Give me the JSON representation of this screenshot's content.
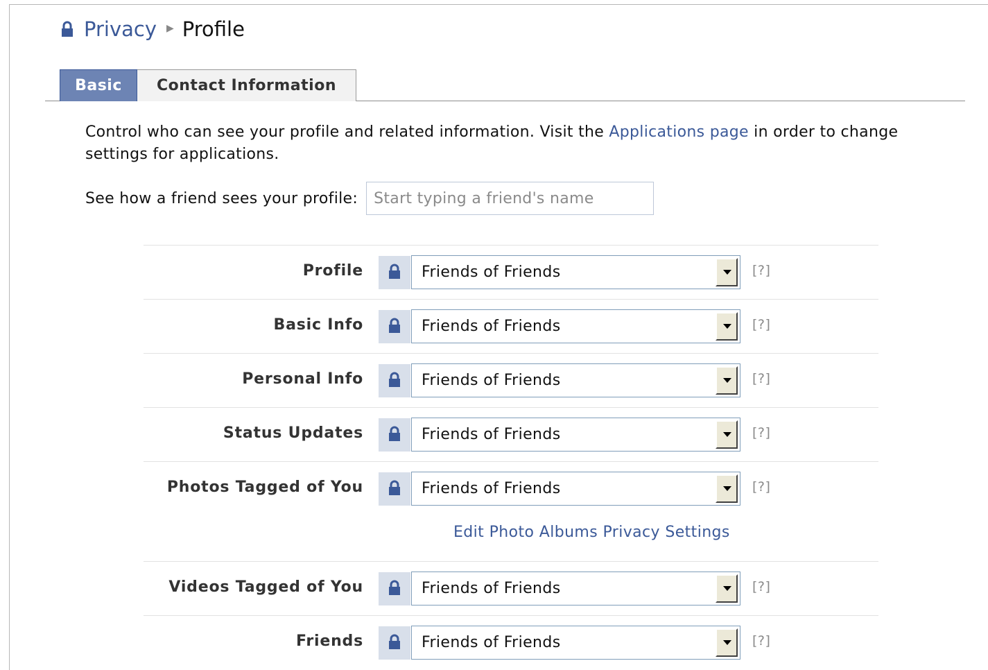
{
  "breadcrumb": {
    "icon": "lock-icon",
    "parent": "Privacy",
    "separator": "▶",
    "current": "Profile"
  },
  "tabs": [
    {
      "label": "Basic",
      "active": true
    },
    {
      "label": "Contact Information",
      "active": false
    }
  ],
  "description": {
    "before_link": "Control who can see your profile and related information. Visit the ",
    "link": "Applications page",
    "after_link": " in order to change settings for applications."
  },
  "preview": {
    "label": "See how a friend sees your profile:",
    "placeholder": "Start typing a friend's name",
    "value": ""
  },
  "settings": [
    {
      "label": "Profile",
      "value": "Friends of Friends",
      "help": "[?]"
    },
    {
      "label": "Basic Info",
      "value": "Friends of Friends",
      "help": "[?]"
    },
    {
      "label": "Personal Info",
      "value": "Friends of Friends",
      "help": "[?]"
    },
    {
      "label": "Status Updates",
      "value": "Friends of Friends",
      "help": "[?]"
    },
    {
      "label": "Photos Tagged of You",
      "value": "Friends of Friends",
      "help": "[?]",
      "extra_link": "Edit Photo Albums Privacy Settings"
    },
    {
      "label": "Videos Tagged of You",
      "value": "Friends of Friends",
      "help": "[?]"
    },
    {
      "label": "Friends",
      "value": "Friends of Friends",
      "help": "[?]"
    }
  ],
  "colors": {
    "link": "#3b5998",
    "active_tab": "#6d84b4",
    "lock_bg": "#d8dfea",
    "lock_icon": "#3b5998"
  }
}
